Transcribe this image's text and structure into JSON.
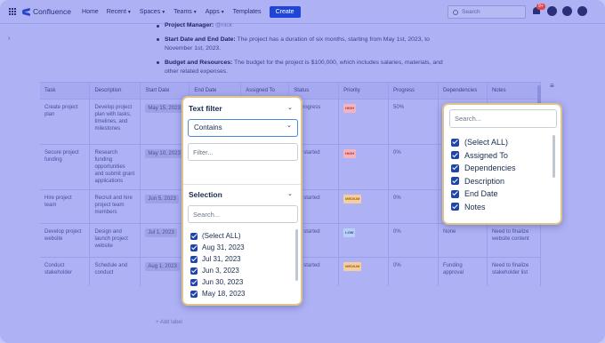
{
  "nav": {
    "product": "Confluence",
    "items": [
      "Home",
      "Recent",
      "Spaces",
      "Teams",
      "Apps",
      "Templates"
    ],
    "create_label": "Create",
    "search_placeholder": "Search",
    "notification_count": "9+"
  },
  "doc": {
    "bullets": [
      {
        "label": "Project Manager:",
        "text": " @nick"
      },
      {
        "label": "Start Date and End Date:",
        "text": " The project has a duration of six months, starting from May 1st, 2023, to November 1st, 2023."
      },
      {
        "label": "Budget and Resources:",
        "text": " The budget for the project is $100,000, which includes salaries, materials, and other related expenses."
      }
    ]
  },
  "table": {
    "headers": [
      "Task",
      "Description",
      "Start Date",
      "End Date",
      "Assigned To",
      "Status",
      "Priority",
      "Progress",
      "Dependencies",
      "Notes"
    ],
    "rows": [
      {
        "task": "Create project plan",
        "description": "Develop project plan with tasks, timelines, and milestones",
        "start": "May 15, 2023",
        "status": "In progress",
        "priority": "HIGH",
        "progress": "50%",
        "dependencies": "",
        "notes": ""
      },
      {
        "task": "Secure project funding",
        "description": "Research funding opportunities and submit grant applications",
        "start": "May 10, 2023",
        "status": "Not started",
        "priority": "HIGH",
        "progress": "0%",
        "dependencies": "",
        "notes": ""
      },
      {
        "task": "Hire project team",
        "description": "Recruit and hire project team members",
        "start": "Jun 5, 2023",
        "status": "Not started",
        "priority": "MEDIUM",
        "progress": "0%",
        "dependencies": "",
        "notes": ""
      },
      {
        "task": "Develop project website",
        "description": "Design and launch project website",
        "start": "Jul 1, 2023",
        "status": "Not started",
        "priority": "LOW",
        "progress": "0%",
        "dependencies": "None",
        "notes": "Need to finalize website content"
      },
      {
        "task": "Conduct stakeholder",
        "description": "Schedule and conduct",
        "start": "Aug 1, 2023",
        "status": "Not started",
        "priority": "MEDIUM",
        "progress": "0%",
        "dependencies": "Funding approval",
        "notes": "Need to finalize stakeholder list"
      }
    ],
    "add_label": "+ Add label"
  },
  "filter_popup": {
    "text_filter_title": "Text filter",
    "operator": "Contains",
    "filter_placeholder": "Filter...",
    "selection_title": "Selection",
    "search_placeholder": "Search...",
    "options": [
      "(Select ALL)",
      "Aug 31, 2023",
      "Jul 31, 2023",
      "Jun 3, 2023",
      "Jun 30, 2023",
      "May 18, 2023"
    ]
  },
  "columns_popup": {
    "search_placeholder": "Search...",
    "options": [
      "(Select ALL)",
      "Assigned To",
      "Dependencies",
      "Description",
      "End Date",
      "Notes"
    ]
  },
  "colors": {
    "accent": "#1f45d6",
    "checkbox": "#1f45a8",
    "popup_border": "#dcc48a",
    "high": "#e0474c",
    "medium": "#e08a2c",
    "low": "#3d7be6"
  }
}
